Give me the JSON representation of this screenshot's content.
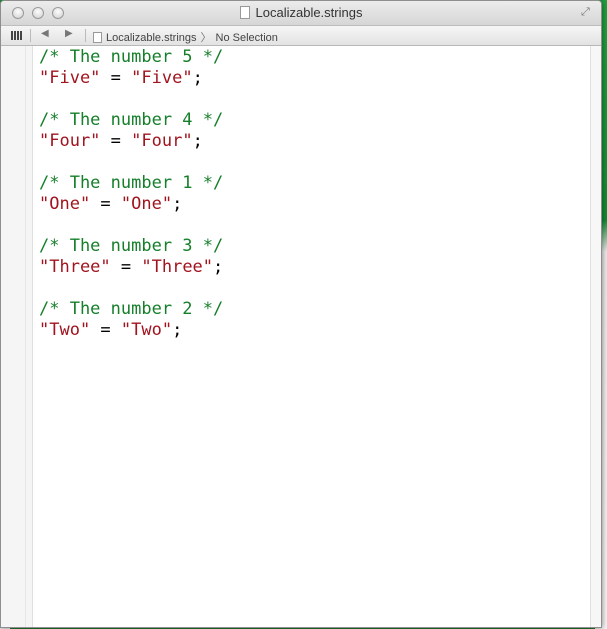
{
  "window": {
    "title": "Localizable.strings"
  },
  "jumpbar": {
    "file": "Localizable.strings",
    "selection": "No Selection"
  },
  "editor": {
    "lines": [
      {
        "comment": "/* The number 5 */",
        "key": "\"Five\"",
        "value": "\"Five\""
      },
      {
        "comment": "/* The number 4 */",
        "key": "\"Four\"",
        "value": "\"Four\""
      },
      {
        "comment": "/* The number 1 */",
        "key": "\"One\"",
        "value": "\"One\""
      },
      {
        "comment": "/* The number 3 */",
        "key": "\"Three\"",
        "value": "\"Three\""
      },
      {
        "comment": "/* The number 2 */",
        "key": "\"Two\"",
        "value": "\"Two\""
      }
    ],
    "equals": " = ",
    "terminator": ";"
  },
  "colors": {
    "comment": "#157f2a",
    "string": "#a1141f"
  }
}
